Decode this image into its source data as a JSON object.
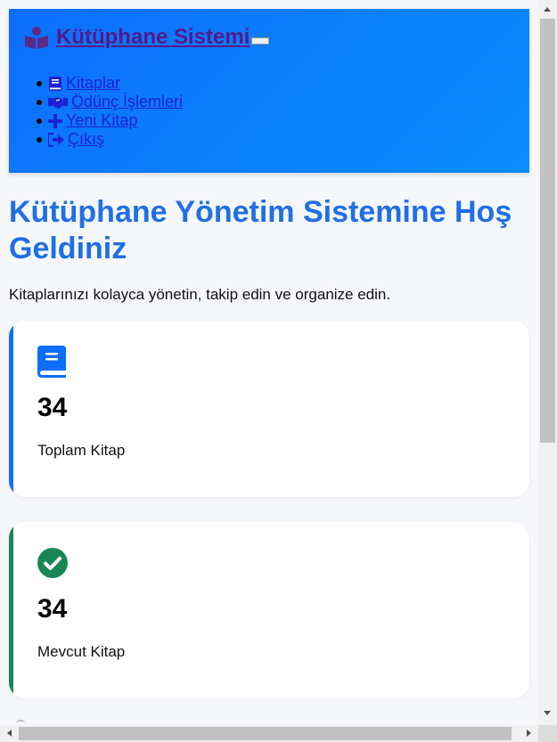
{
  "header": {
    "brand_label": " Kütüphane Sistemi ",
    "nav": [
      {
        "label": " Kitaplar",
        "icon": "book-icon"
      },
      {
        "label": " Ödünç İşlemleri",
        "icon": "handshake-icon"
      },
      {
        "label": " Yeni Kitap",
        "icon": "plus-icon"
      },
      {
        "label": " Çıkış",
        "icon": "sign-out-icon"
      }
    ]
  },
  "main": {
    "title": "Kütüphane Yönetim Sistemine Hoş Geldiniz",
    "intro": "Kitaplarınızı kolayca yönetin, takip edin ve organize edin.",
    "stats": [
      {
        "value": "34",
        "label": "Toplam Kitap",
        "icon": "book-icon",
        "color": "#0d6efd"
      },
      {
        "value": "34",
        "label": "Mevcut Kitap",
        "icon": "check-circle-icon",
        "color": "#198754"
      }
    ]
  },
  "colors": {
    "header_gradient_start": "#0d6efd",
    "header_gradient_end": "#0a8cff",
    "title": "#1f6fe5",
    "brand_link": "#551a8b",
    "nav_link": "#1f1fd6"
  }
}
